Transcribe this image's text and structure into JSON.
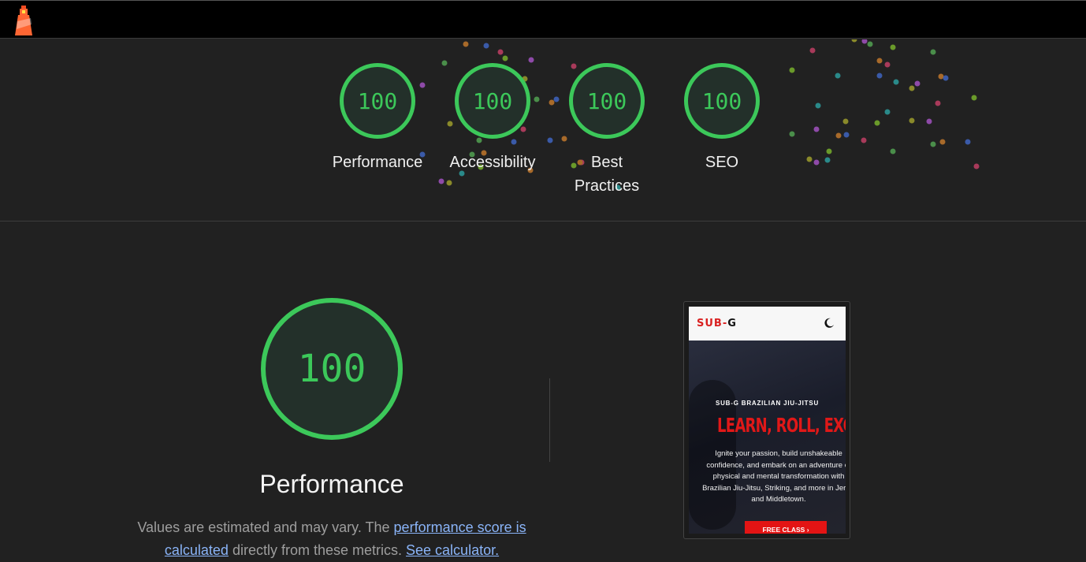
{
  "colors": {
    "pass": "#3cc85a",
    "link": "#8ab4f8",
    "background": "#212121",
    "topbar": "#000000"
  },
  "topbar": {
    "logo_icon": "lighthouse-icon"
  },
  "scores": [
    {
      "value": "100",
      "label": "Performance"
    },
    {
      "value": "100",
      "label": "Accessibility"
    },
    {
      "value": "100",
      "label": "Best Practices"
    },
    {
      "value": "100",
      "label": "SEO"
    }
  ],
  "performance": {
    "score": "100",
    "title": "Performance",
    "desc_prefix": "Values are estimated and may vary. The ",
    "link_score": "performance score is calculated",
    "desc_middle": " directly from these metrics. ",
    "link_calc": "See calculator."
  },
  "screenshot": {
    "brand_red": "SUB-",
    "brand_dark": "G",
    "subtitle": "SUB-G BRAZILIAN JIU-JITSU",
    "headline": "LEARN, ROLL, EXCE",
    "body": "Ignite your passion, build unshakeable confidence, and embark on an adventure of physical and mental transformation with Brazilian Jiu-Jitsu, Striking, and more in Jervis and Middletown.",
    "button": "FREE CLASS"
  }
}
